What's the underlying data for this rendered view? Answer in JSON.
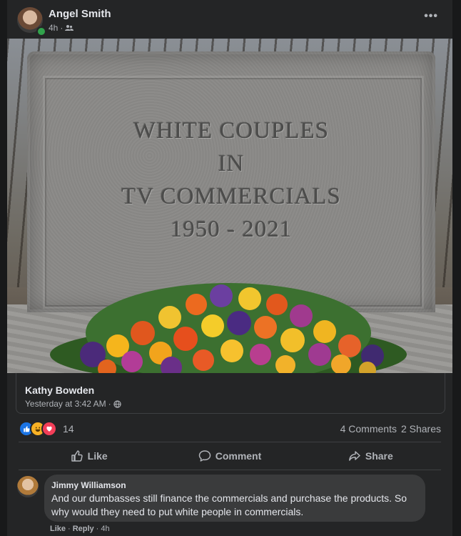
{
  "post": {
    "author": "Angel Smith",
    "time": "4h",
    "separator": "·",
    "audience_icon": "friends-icon",
    "more_label": "•••"
  },
  "image": {
    "engraving": [
      "WHITE COUPLES",
      "IN",
      "TV COMMERCIALS",
      "1950 - 2021"
    ]
  },
  "shared_from": {
    "name": "Kathy Bowden",
    "time": "Yesterday at 3:42 AM",
    "separator": "·",
    "audience_icon": "globe-icon"
  },
  "stats": {
    "reactions": [
      "like-icon",
      "haha-icon",
      "love-icon"
    ],
    "reaction_count": "14",
    "comments": "4 Comments",
    "shares": "2 Shares"
  },
  "actions": [
    {
      "label": "Like",
      "icon": "thumbs-up-icon"
    },
    {
      "label": "Comment",
      "icon": "comment-icon"
    },
    {
      "label": "Share",
      "icon": "share-icon"
    }
  ],
  "comment": {
    "author": "Jimmy Williamson",
    "text": "And our dumbasses still finance the commercials and purchase the products. So why would they need to put white people in commercials.",
    "like": "Like",
    "reply": "Reply",
    "separator": "·",
    "time": "4h"
  },
  "colors": {
    "background": "#242526",
    "text": "#e4e6eb",
    "secondary_text": "#b0b3b8",
    "like_blue": "#1b74e4",
    "online_green": "#31a24c"
  }
}
